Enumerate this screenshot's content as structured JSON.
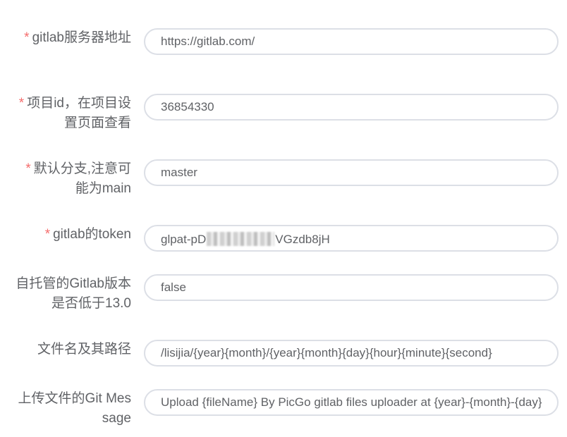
{
  "form": {
    "fields": [
      {
        "required": true,
        "required_mark": "*",
        "label": "gitlab服务器地址",
        "value": "https://gitlab.com/"
      },
      {
        "required": true,
        "required_mark": "*",
        "label": "项目id，在项目设置页面查看",
        "value": "36854330"
      },
      {
        "required": true,
        "required_mark": "*",
        "label": "默认分支,注意可能为main",
        "value": "master"
      },
      {
        "required": true,
        "required_mark": "*",
        "label": "gitlab的token",
        "value_prefix": "glpat-pD",
        "value_suffix": "VGzdb8jH",
        "masked": true
      },
      {
        "required": false,
        "label": "自托管的Gitlab版本是否低于13.0",
        "value": "false"
      },
      {
        "required": false,
        "label": "文件名及其路径",
        "value": "/lisijia/{year}{month}/{year}{month}{day}{hour}{minute}{second}"
      },
      {
        "required": false,
        "label": "上传文件的Git Message",
        "value": "Upload {fileName} By PicGo gitlab files uploader at {year}-{month}-{day}"
      }
    ]
  },
  "colors": {
    "label_text": "#606266",
    "required_star": "#f56c6c",
    "input_border": "#dcdfe6",
    "input_text": "#606266"
  }
}
